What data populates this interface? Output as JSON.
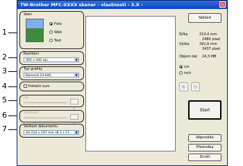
{
  "window": {
    "title": "TW-Brother MFC-XXXX skener - vlastnosti - 3.X -"
  },
  "callouts": [
    "1",
    "2",
    "3",
    "4",
    "5",
    "6",
    "7"
  ],
  "scan": {
    "group_label": "Sken",
    "options": [
      "Foto",
      "Web",
      "Text"
    ],
    "selected": "Foto"
  },
  "resolution": {
    "label": "Rozlišení",
    "value": "300 x 300 dpi"
  },
  "scan_type": {
    "label": "Typ grafiky",
    "value": "Barevná 24 bitů"
  },
  "reduce_noise": {
    "label": "Potlačit šum",
    "checked": false
  },
  "brightness": {
    "label": "Jas",
    "value": "0"
  },
  "contrast": {
    "label": "Kontrast",
    "value": "0"
  },
  "doc_size": {
    "label": "Velikost dokumentu",
    "value": "A4 210 x 297 mm (8.3 x 11..."
  },
  "right": {
    "preview_button": "Náhled",
    "width_label": "Šířka",
    "width_mm": "210,0 mm",
    "width_px": "2480 pixel",
    "height_label": "Výška",
    "height_mm": "291,6 mm",
    "height_px": "3437 pixel",
    "data_label": "Objem dat",
    "data_value": "24,3 MB",
    "unit_cm": "cm",
    "unit_inch": "inch",
    "start_button": "Start",
    "help_button": "Nápověda",
    "defaults_button": "Předvolba",
    "cancel_button": "Zrušit"
  }
}
